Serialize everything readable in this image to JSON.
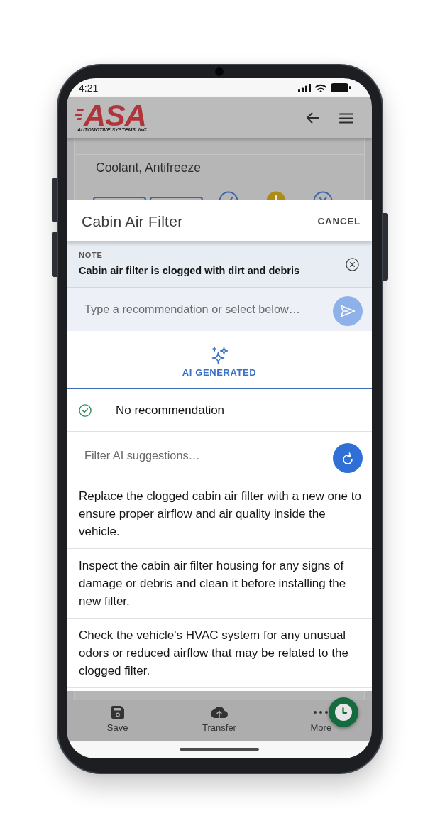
{
  "status_bar": {
    "time": "4:21"
  },
  "app_bar": {
    "logo": {
      "wordmark": "ASA",
      "tagline": "AUTOMOTIVE SYSTEMS, INC."
    }
  },
  "background_card": {
    "title": "Coolant, Antifreeze"
  },
  "sheet": {
    "title": "Cabin Air Filter",
    "cancel_button": "CANCEL",
    "note": {
      "label": "NOTE",
      "text": "Cabin air filter is clogged with dirt and debris"
    },
    "recommendation_input": {
      "placeholder": "Type a recommendation or select below…"
    },
    "send_button": {
      "disabled": true
    },
    "tabs": [
      {
        "label": "AI GENERATED",
        "selected": true
      }
    ],
    "no_recommendation": {
      "label": "No recommendation",
      "checked": true
    },
    "filter_input": {
      "placeholder": "Filter AI suggestions…"
    },
    "suggestions": [
      {
        "text": "Replace the clogged cabin air filter with a new one to ensure proper airflow and air quality inside the vehicle.",
        "selected": false
      },
      {
        "text": "Inspect the cabin air filter housing for any signs of damage or debris and clean it before installing the new filter.",
        "selected": false
      },
      {
        "text": "Check the vehicle's HVAC system for any unusual odors or reduced airflow that may be related to the clogged filter.",
        "selected": false
      }
    ]
  },
  "bottom_nav": {
    "items": [
      {
        "kind": "save",
        "label": "Save"
      },
      {
        "kind": "transfer",
        "label": "Transfer"
      },
      {
        "kind": "more",
        "label": "More"
      }
    ]
  }
}
